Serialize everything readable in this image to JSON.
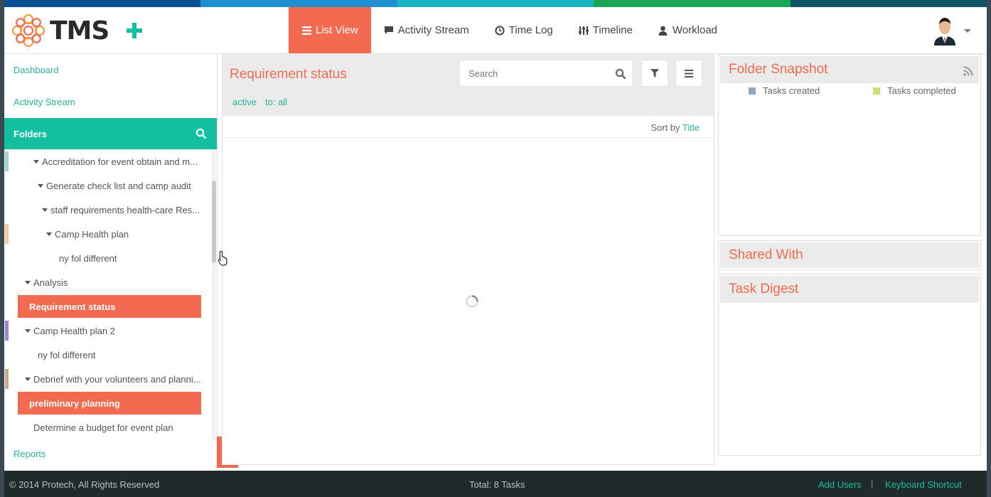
{
  "stripe_colors": [
    "#0a4f8f",
    "#1f8fd0",
    "#17b5c2",
    "#1aa556",
    "#0e5266"
  ],
  "header": {
    "brand": "TMS",
    "nav": [
      {
        "label": "List View",
        "icon": "list-icon",
        "active": true
      },
      {
        "label": "Activity Stream",
        "icon": "comment-icon",
        "active": false
      },
      {
        "label": "Time Log",
        "icon": "clock-icon",
        "active": false
      },
      {
        "label": "Timeline",
        "icon": "sliders-icon",
        "active": false
      },
      {
        "label": "Workload",
        "icon": "user-icon",
        "active": false
      }
    ]
  },
  "sidebar": {
    "dashboard": "Dashboard",
    "activity_stream": "Activity Stream",
    "folders": "Folders",
    "reports": "Reports",
    "tree": [
      {
        "label": "Accreditation for event obtain and m...",
        "indent": 28,
        "caret": true,
        "selected": false,
        "mark": "#9fd6d3"
      },
      {
        "label": "Generate check list and camp audit",
        "indent": 34,
        "caret": true,
        "selected": false,
        "mark": ""
      },
      {
        "label": "staff requirements health-care Res...",
        "indent": 40,
        "caret": true,
        "selected": false,
        "mark": ""
      },
      {
        "label": "Camp Health plan",
        "indent": 46,
        "caret": true,
        "selected": false,
        "mark": "#f4c9a2"
      },
      {
        "label": "ny fol different",
        "indent": 64,
        "caret": false,
        "selected": false,
        "mark": ""
      },
      {
        "label": "Analysis",
        "indent": 16,
        "caret": true,
        "selected": false,
        "mark": ""
      },
      {
        "label": "Requirement status",
        "indent": 0,
        "caret": false,
        "selected": true,
        "mark": ""
      },
      {
        "label": "Camp Health plan 2",
        "indent": 16,
        "caret": true,
        "selected": false,
        "mark": "#9b86c9"
      },
      {
        "label": "ny fol different",
        "indent": 34,
        "caret": false,
        "selected": false,
        "mark": ""
      },
      {
        "label": "Debrief with your volunteers and planni...",
        "indent": 16,
        "caret": true,
        "selected": false,
        "mark": "#c8a98c"
      },
      {
        "label": "preliminary planning",
        "indent": 0,
        "caret": false,
        "selected": true,
        "mark": ""
      },
      {
        "label": "Determine a budget for event plan",
        "indent": 28,
        "caret": false,
        "selected": false,
        "mark": ""
      }
    ]
  },
  "center": {
    "title": "Requirement status",
    "search_placeholder": "Search",
    "filter_active": "active",
    "filter_to": "to: all",
    "sort_prefix": "Sort by",
    "sort_field": "Title"
  },
  "right": {
    "snapshot_title": "Folder Snapshot",
    "legend": [
      {
        "label": "Tasks created",
        "color": "#8fa8c8"
      },
      {
        "label": "Tasks completed",
        "color": "#cde07a"
      }
    ],
    "shared_title": "Shared With",
    "digest_title": "Task Digest"
  },
  "footer": {
    "copyright": "© 2014 Protech, All Rights Reserved",
    "total": "Total: 8 Tasks",
    "add_users": "Add Users",
    "separator": "|",
    "keyboard": "Keyboard Shortcut"
  }
}
